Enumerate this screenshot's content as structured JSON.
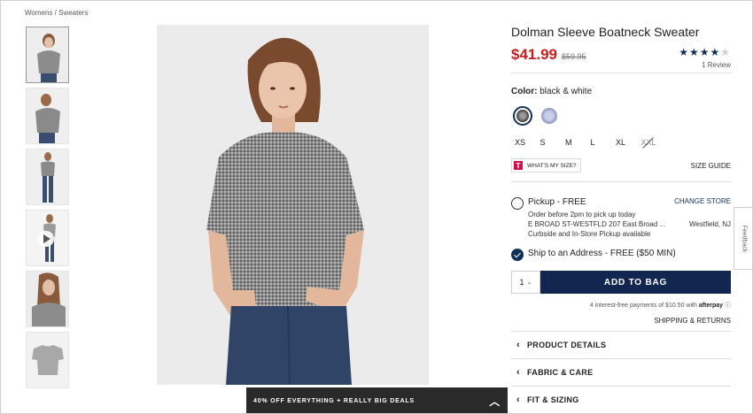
{
  "breadcrumb": {
    "category": "Womens",
    "separator": " / ",
    "subcategory": "Sweaters"
  },
  "product": {
    "title": "Dolman Sleeve Boatneck Sweater",
    "price": "$41.99",
    "original_price": "$59.95",
    "rating_stars": "★★★★",
    "rating_empty": "★",
    "rating_value": 4,
    "reviews": "1 Review"
  },
  "color": {
    "label": "Color:",
    "value": "black & white",
    "swatches": [
      "#3a3a3a",
      "#7a86b8"
    ]
  },
  "sizes": [
    "XS",
    "S",
    "M",
    "L",
    "XL",
    "XXL"
  ],
  "size_info": {
    "badge": "T",
    "whats_my_size": "WHAT'S MY SIZE?",
    "size_guide": "SIZE GUIDE"
  },
  "fulfillment": {
    "pickup_label": "Pickup - FREE",
    "change_store": "CHANGE STORE",
    "pickup_note": "Order before 2pm to pick up today",
    "store_address": "E BROAD ST-WESTFLD 207 East Broad ...",
    "store_city": "Westfield, NJ",
    "pickup_options": "Curbside and In-Store Pickup available",
    "ship_label": "Ship to an Address - FREE ($50 MIN)"
  },
  "cart": {
    "quantity": "1",
    "add_to_bag": "ADD TO BAG"
  },
  "afterpay": {
    "text": "4 interest-free payments of $10.50 with",
    "brand": "afterpay",
    "info": "ⓘ"
  },
  "links": {
    "shipping_returns": "SHIPPING & RETURNS"
  },
  "accordion": [
    {
      "label": "PRODUCT DETAILS"
    },
    {
      "label": "FABRIC & CARE"
    },
    {
      "label": "FIT & SIZING"
    }
  ],
  "promo": {
    "text": "40% OFF EVERYTHING + REALLY BIG DEALS"
  },
  "feedback": {
    "label": "Feedback"
  },
  "colors": {
    "price_red": "#cc1b1b",
    "navy": "#122650",
    "star": "#123056"
  }
}
